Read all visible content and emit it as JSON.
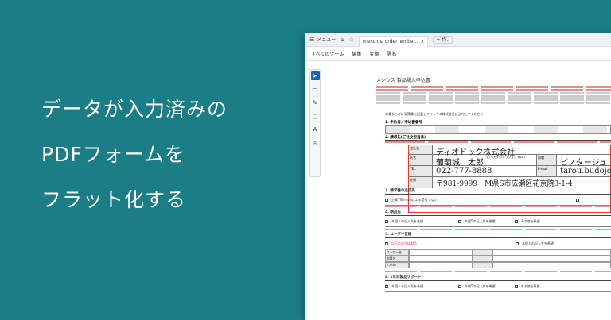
{
  "headline": {
    "line1": "データが入力済みの",
    "line2": "PDFフォームを",
    "line3": "フラット化する"
  },
  "viewer": {
    "menu_label": "メニュー",
    "tab_title": "mescius_order_embe...",
    "tab_close": "×",
    "new_tab": "+ 作..",
    "toolbar": [
      "すべてのツール",
      "編集",
      "変換",
      "署名"
    ]
  },
  "form": {
    "title": "メシウス 製品購入申込書",
    "sec_notice": "本書ならびに見積書に記載してメシウス株式会社に送付してください",
    "sec1": "1. 申込者／申込書番号",
    "sec2": "2. 請求先(ご注文担当者)",
    "company_label": "会社名",
    "company_value": "ディオドック株式会社",
    "name_label": "氏名",
    "name_value": "葡萄城　太郎",
    "furigana_label": "(フリガナ)",
    "furigana_value": "ブドウジョウ タロウ",
    "dept_label": "部署",
    "dept_value": "ピノタージュ",
    "tel_label": "TEL",
    "tel_value": "022-777-8888",
    "email_label": "E-mail",
    "email_value": "tarou.budojo@m",
    "addr_label": "住所",
    "addr_value": "〒981-9999　M県S市広瀬区花京院3-1-4",
    "sec3": "3. 請求書の送信先",
    "sec4": "4. 納品先",
    "sec5": "5. ユーザー登録",
    "sec6": "6. 1年目製品サポート",
    "opt_same1": "企業TSB-mailによる受付でない",
    "opt_same2": "本個人の記入先を希望",
    "opt_same3": "本個5の記入先を希望",
    "opt_other": "その他を希望",
    "user_label": "ユーザー名",
    "dept2_label": "部署名",
    "email2_label": "E-mail",
    "note": "以下の方法は製品"
  }
}
